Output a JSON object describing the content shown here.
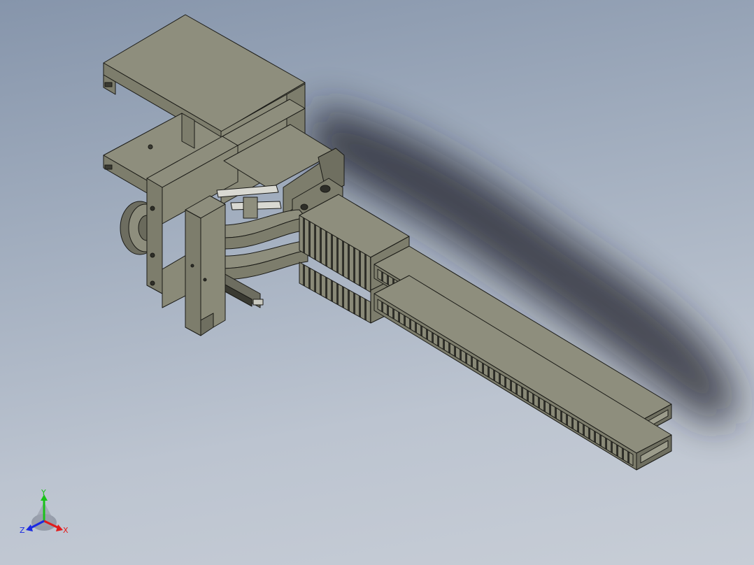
{
  "viewport": {
    "model": "gripper-assembly",
    "background_top": "#8695ab",
    "background_bottom": "#c7cdd6"
  },
  "colors": {
    "part_top": "#8e8e7d",
    "part_side": "#7d7d6c",
    "part_dark": "#5f5f52",
    "edge": "#1a1a16",
    "shadow": "#1c1f26"
  },
  "triad": {
    "y_label": "Y",
    "x_label": "X",
    "z_label": "Z",
    "y_color": "#19c219",
    "x_color": "#e21b1b",
    "z_color": "#1b2ae2"
  }
}
